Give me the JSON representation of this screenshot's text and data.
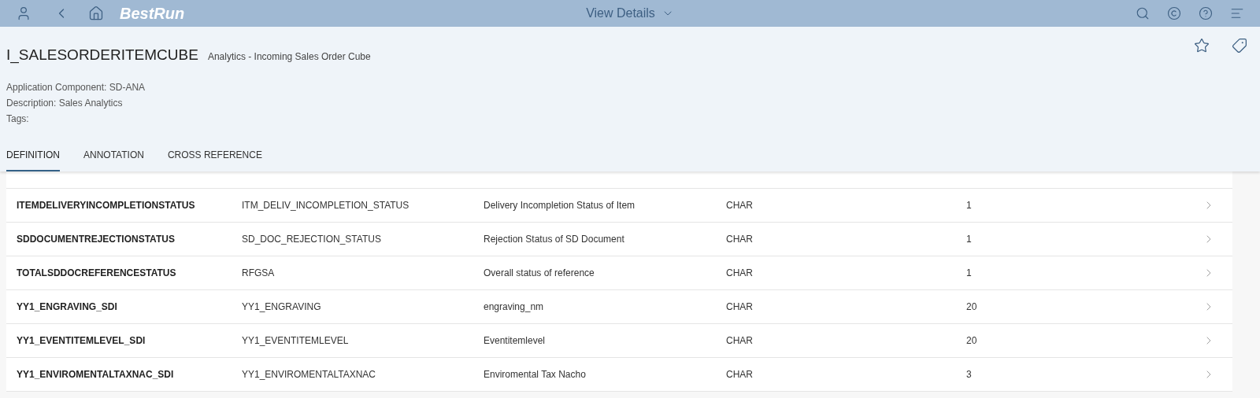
{
  "shell": {
    "logo": "BestRun",
    "title": "View Details"
  },
  "header": {
    "title": "I_SALESORDERITEMCUBE",
    "subtitle": "Analytics - Incoming Sales Order Cube",
    "attributes": [
      "Application Component: SD-ANA",
      "Description: Sales Analytics",
      "Tags:"
    ]
  },
  "tabs": [
    {
      "label": "DEFINITION",
      "selected": true
    },
    {
      "label": "ANNOTATION",
      "selected": false
    },
    {
      "label": "CROSS REFERENCE",
      "selected": false
    }
  ],
  "table": {
    "rows": [
      {
        "field": "ITEMDELIVERYINCOMPLETIONSTATUS",
        "data_element": "ITM_DELIV_INCOMPLETION_STATUS",
        "description": "Delivery Incompletion Status of Item",
        "type": "CHAR",
        "length": "1"
      },
      {
        "field": "SDDOCUMENTREJECTIONSTATUS",
        "data_element": "SD_DOC_REJECTION_STATUS",
        "description": "Rejection Status of SD Document",
        "type": "CHAR",
        "length": "1"
      },
      {
        "field": "TOTALSDDOCREFERENCESTATUS",
        "data_element": "RFGSA",
        "description": "Overall status of reference",
        "type": "CHAR",
        "length": "1"
      },
      {
        "field": "YY1_ENGRAVING_SDI",
        "data_element": "YY1_ENGRAVING",
        "description": "engraving_nm",
        "type": "CHAR",
        "length": "20"
      },
      {
        "field": "YY1_EVENTITEMLEVEL_SDI",
        "data_element": "YY1_EVENTITEMLEVEL",
        "description": "Eventitemlevel",
        "type": "CHAR",
        "length": "20"
      },
      {
        "field": "YY1_ENVIROMENTALTAXNAC_SDI",
        "data_element": "YY1_ENVIROMENTALTAXNAC",
        "description": "Enviromental Tax Nacho",
        "type": "CHAR",
        "length": "3"
      }
    ]
  }
}
